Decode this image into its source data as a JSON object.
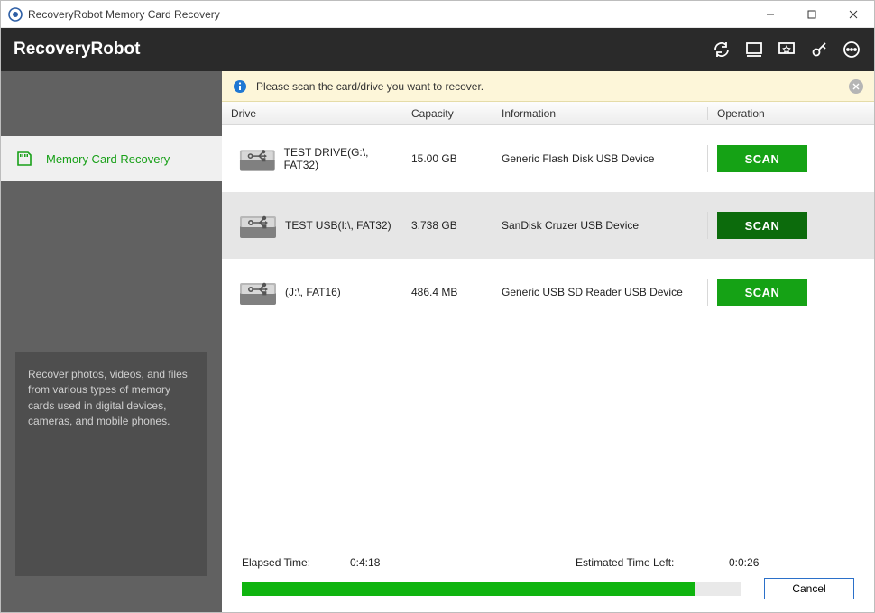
{
  "window": {
    "title": "RecoveryRobot Memory Card Recovery"
  },
  "brand": "RecoveryRobot",
  "infobar": {
    "text": "Please scan the card/drive you want to recover."
  },
  "sidebar": {
    "active": {
      "label": "Memory Card Recovery"
    },
    "description": "Recover photos, videos, and files from various types of memory cards used in digital devices, cameras, and mobile phones."
  },
  "columns": {
    "drive": "Drive",
    "capacity": "Capacity",
    "information": "Information",
    "operation": "Operation"
  },
  "drives": [
    {
      "name": "TEST DRIVE(G:\\, FAT32)",
      "capacity": "15.00 GB",
      "info": "Generic  Flash Disk  USB Device",
      "selected": false
    },
    {
      "name": "TEST USB(I:\\, FAT32)",
      "capacity": "3.738 GB",
      "info": "SanDisk  Cruzer  USB Device",
      "selected": true
    },
    {
      "name": "(J:\\, FAT16)",
      "capacity": "486.4 MB",
      "info": "Generic  USB SD Reader  USB Device",
      "selected": false
    }
  ],
  "buttons": {
    "scan": "SCAN",
    "cancel": "Cancel"
  },
  "progress": {
    "elapsed_label": "Elapsed Time:",
    "elapsed_value": "0:4:18",
    "eta_label": "Estimated Time Left:",
    "eta_value": "0:0:26",
    "percent": 90.8
  }
}
